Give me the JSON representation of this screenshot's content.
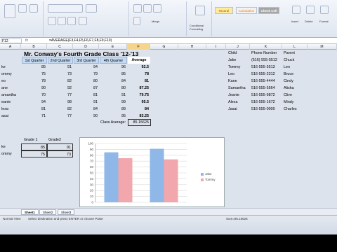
{
  "ribbon": {
    "merge_label": "Merge",
    "format_label": "Conditional Formatting",
    "style_neutral": "Neutral",
    "style_calculation": "Calculation",
    "style_check_cell": "Check Cell",
    "insert_label": "Insert",
    "delete_label": "Delete",
    "format_cells_label": "Format"
  },
  "formula_bar": {
    "name_box": "F12",
    "fx": "fx",
    "formula": "=AVERAGE(F3,F4,F5,F6,F7,F8,F9,F10)"
  },
  "columns": [
    "A",
    "B",
    "C",
    "D",
    "E",
    "F",
    "G",
    "H",
    "I",
    "J",
    "K",
    "L",
    "M"
  ],
  "rows": [
    "1",
    "2",
    "3",
    "4",
    "5",
    "6",
    "7",
    "8",
    "9",
    "10",
    "11",
    "12",
    "13",
    "14",
    "15",
    "16",
    "17",
    "18",
    "19",
    "20",
    "21",
    "22",
    "23"
  ],
  "table": {
    "title": "Mr. Conway's Fourth Grade Class '12-'13",
    "headers": [
      "1st Quarter",
      "2nd Quarter",
      "3rd Quarter",
      "4th Quarter",
      "Average"
    ],
    "students": [
      {
        "name": "ke",
        "q": [
          "85",
          "91",
          "94",
          "96"
        ],
        "avg": "92.5"
      },
      {
        "name": "ommy",
        "q": [
          "75",
          "73",
          "79",
          "85"
        ],
        "avg": "78"
      },
      {
        "name": "eo",
        "q": [
          "78",
          "82",
          "80",
          "84"
        ],
        "avg": "81"
      },
      {
        "name": "ane",
        "q": [
          "90",
          "92",
          "87",
          "80"
        ],
        "avg": "87.25"
      },
      {
        "name": "amantha",
        "q": [
          "70",
          "77",
          "81",
          "91"
        ],
        "avg": "79.75"
      },
      {
        "name": "eanie",
        "q": [
          "94",
          "98",
          "91",
          "99"
        ],
        "avg": "95.5"
      },
      {
        "name": "lexa",
        "q": [
          "81",
          "82",
          "84",
          "89"
        ],
        "avg": "84"
      },
      {
        "name": "asai",
        "q": [
          "71",
          "77",
          "90",
          "95"
        ],
        "avg": "83.25"
      }
    ],
    "class_average_label": "Class Average:",
    "class_average": "85.15625"
  },
  "contacts": {
    "headers": [
      "Child",
      "Phone Number",
      "Parent"
    ],
    "rows": [
      [
        "Jake",
        "(516) 555-5512",
        "Chuck"
      ],
      [
        "Tommy",
        "516-555-5513",
        "Len"
      ],
      [
        "Leo",
        "516-555-2312",
        "Bruce"
      ],
      [
        "Kane",
        "516-555-4444",
        "Cindy"
      ],
      [
        "Samantha",
        "516-555-5564",
        "Alisha"
      ],
      [
        "Jeanie",
        "516-555-9872",
        "Clive"
      ],
      [
        "Alexa",
        "516-555-1672",
        "Mindy"
      ],
      [
        "Jasai",
        "516-555-0000",
        "Charles"
      ]
    ]
  },
  "small_table": {
    "headers": [
      "Grade 1",
      "Grade2"
    ],
    "rows": [
      {
        "name": "ke",
        "values": [
          "85",
          "91"
        ]
      },
      {
        "name": "ommy",
        "values": [
          "75",
          "73"
        ]
      }
    ]
  },
  "chart_data": {
    "type": "bar",
    "categories": [
      "1",
      "2"
    ],
    "series": [
      {
        "name": "Jake",
        "values": [
          85,
          91
        ],
        "color": "#8fb8e8"
      },
      {
        "name": "Tommy",
        "values": [
          75,
          73
        ],
        "color": "#f2a7ad"
      }
    ],
    "ylim": [
      0,
      100
    ],
    "yticks": [
      "100",
      "90",
      "80",
      "70",
      "60",
      "50",
      "40",
      "30",
      "20",
      "10",
      "0"
    ],
    "grid": true,
    "legend": "right"
  },
  "sheet_tabs": [
    "Sheet1",
    "Sheet2",
    "Sheet3"
  ],
  "status_bar": {
    "left": "Normal View",
    "message": "Select destination and press ENTER or choose Paste",
    "sum": "Sum=85.15625"
  }
}
